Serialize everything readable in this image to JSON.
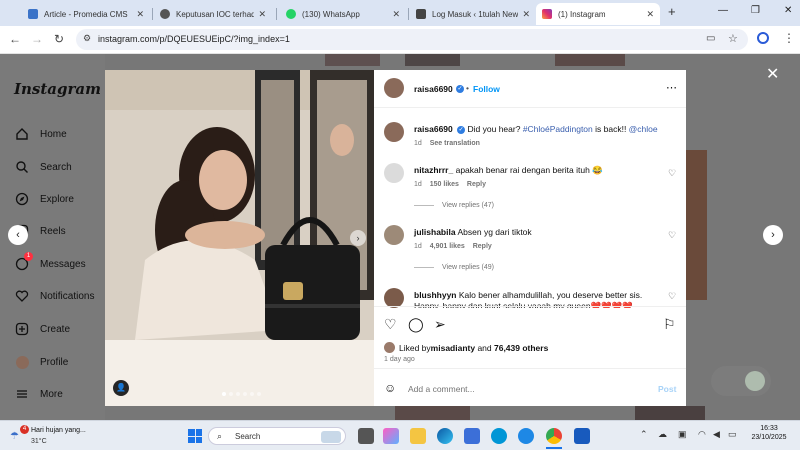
{
  "browser": {
    "tabs": [
      {
        "title": "Article - Promedia CMS",
        "active": false,
        "color": "#3b73c8"
      },
      {
        "title": "Keputusan IOC terhadap",
        "active": false,
        "color": "#555555"
      },
      {
        "title": "(130) WhatsApp",
        "active": false,
        "color": "#25d366"
      },
      {
        "title": "Log Masuk ‹ 1tulah News",
        "active": false,
        "color": "#444444"
      },
      {
        "title": "(1) Instagram",
        "active": true,
        "color": "#e1306c"
      }
    ],
    "url": "instagram.com/p/DQEUESUEipC/?img_index=1"
  },
  "sidebar": {
    "logo": "Instagram",
    "items": [
      {
        "label": "Home",
        "icon": "home-icon"
      },
      {
        "label": "Search",
        "icon": "search-icon"
      },
      {
        "label": "Explore",
        "icon": "compass-icon"
      },
      {
        "label": "Reels",
        "icon": "reels-icon"
      },
      {
        "label": "Messages",
        "icon": "messenger-icon",
        "badge": "1"
      },
      {
        "label": "Notifications",
        "icon": "heart-icon"
      },
      {
        "label": "Create",
        "icon": "plus-icon"
      },
      {
        "label": "Profile",
        "icon": "profile-avatar"
      },
      {
        "label": "More",
        "icon": "menu-icon"
      }
    ]
  },
  "post": {
    "author": "raisa6690",
    "follow": "Follow",
    "caption": {
      "user": "raisa6690",
      "text_pre": "Did you hear? ",
      "hashtag": "#ChloéPaddington",
      "text_mid": " is back!! ",
      "mention": "@chloe",
      "time": "1d",
      "translate": "See translation"
    },
    "comments": [
      {
        "user": "nitazhrrr_",
        "text": "apakah benar rai dengan berita ituh 😂",
        "time": "1d",
        "likes": "150 likes",
        "reply": "Reply",
        "view_replies": "View replies (47)"
      },
      {
        "user": "julishabila",
        "text": "Absen yg dari tiktok",
        "time": "1d",
        "likes": "4,901 likes",
        "reply": "Reply",
        "view_replies": "View replies (49)"
      },
      {
        "user": "blushhyyn",
        "text": "Kalo bener alhamdulillah, you deserve better sis. Happy, happy dan kuat selalu yaaah my queen❤️❤️❤️❤️",
        "time": "",
        "likes": "",
        "reply": "",
        "view_replies": ""
      }
    ],
    "liked_by_prefix": "Liked by ",
    "liked_by_user": "misadianty",
    "liked_by_suffix": " and ",
    "likes_count": "76,439 others",
    "date": "1 day ago",
    "comment_placeholder": "Add a comment...",
    "post_button": "Post"
  },
  "taskbar": {
    "weather_title": "Hari hujan yang...",
    "weather_temp": "31°C",
    "weather_badge": "4",
    "search_placeholder": "Search",
    "time": "16:33",
    "date": "23/10/2025"
  }
}
